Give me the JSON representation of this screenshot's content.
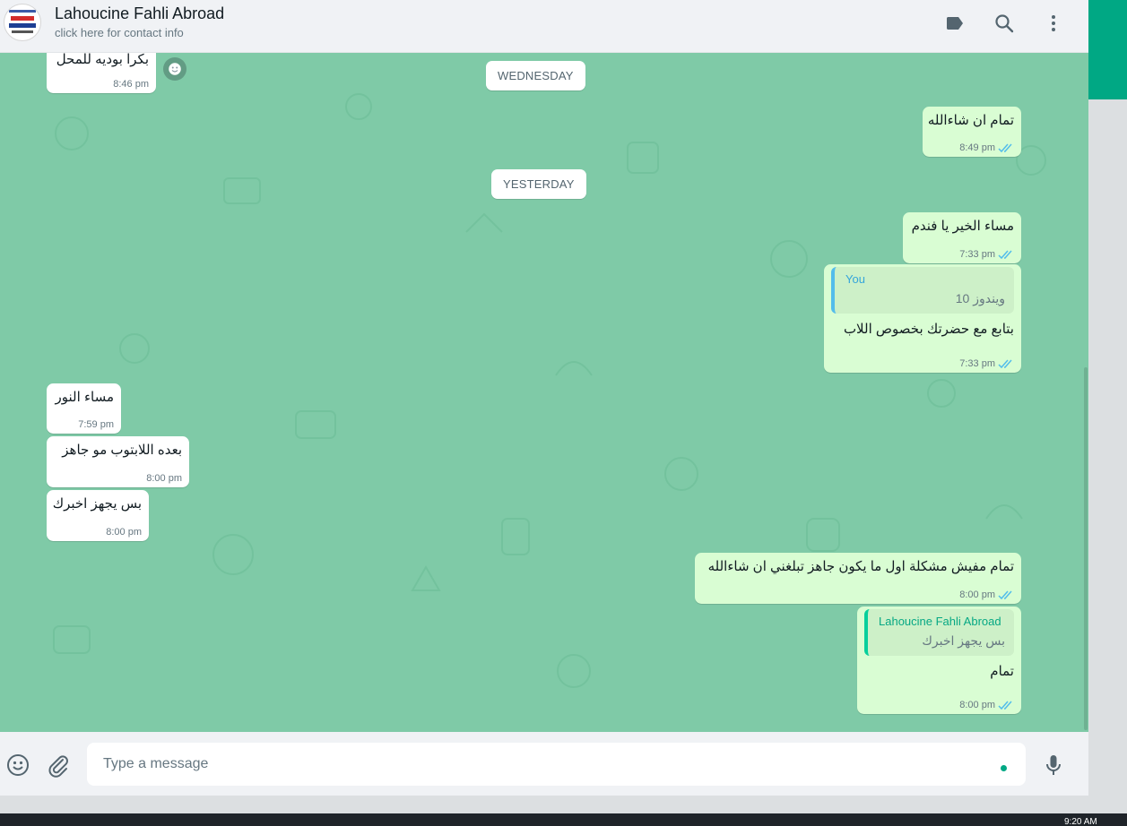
{
  "header": {
    "contact_name": "Lahoucine Fahli Abroad",
    "contact_subtitle": "click here for contact info",
    "icons": [
      "label-icon",
      "search-icon",
      "menu-icon"
    ]
  },
  "dates": {
    "wednesday": "WEDNESDAY",
    "yesterday": "YESTERDAY"
  },
  "messages": [
    {
      "dir": "in",
      "text": "بكرا بوديه للمحل",
      "time": "8:46 pm"
    },
    {
      "dir": "out",
      "text": "تمام ان شاءالله",
      "time": "8:49 pm"
    },
    {
      "dir": "out",
      "text": "مساء الخير يا فندم",
      "time": "7:33 pm"
    },
    {
      "dir": "out",
      "quote_name": "You",
      "quote_text": "ويندوز 10",
      "text": "بتابع مع حضرتك بخصوص اللاب",
      "time": "7:33 pm"
    },
    {
      "dir": "in",
      "text": "مساء النور",
      "time": "7:59 pm"
    },
    {
      "dir": "in",
      "text": "بعده اللابتوب مو جاهز",
      "time": "8:00 pm"
    },
    {
      "dir": "in",
      "text": "بس يجهز اخبرك",
      "time": "8:00 pm"
    },
    {
      "dir": "out",
      "text": "تمام مفيش مشكلة اول ما يكون جاهز تبلغني ان شاءالله",
      "time": "8:00 pm"
    },
    {
      "dir": "out",
      "quote_name": "Lahoucine Fahli Abroad",
      "quote_text": "بس يجهز اخبرك",
      "text": "تمام",
      "time": "8:00 pm"
    }
  ],
  "composer": {
    "placeholder": "Type a message",
    "icons": [
      "emoji-icon",
      "attach-icon",
      "microphone-icon"
    ]
  },
  "taskbar": {
    "clock": "9:20 AM"
  },
  "colors": {
    "chat_bg": "#7fcaa7",
    "outgoing_bubble": "#d9fdd3",
    "incoming_bubble": "#ffffff",
    "read_tick": "#53bdeb",
    "accent": "#00a884"
  }
}
